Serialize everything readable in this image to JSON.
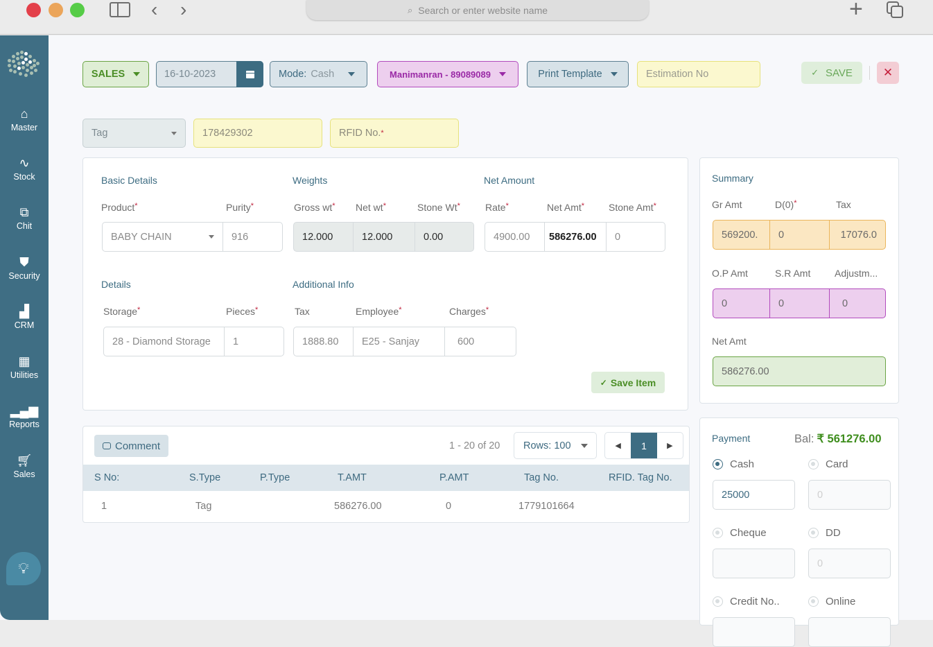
{
  "browser": {
    "url_placeholder": "Search or enter website name"
  },
  "sidebar": {
    "items": [
      {
        "label": "Master",
        "icon": "home-icon"
      },
      {
        "label": "Stock",
        "icon": "activity-icon"
      },
      {
        "label": "Chit",
        "icon": "expand-icon"
      },
      {
        "label": "Security",
        "icon": "shield-icon"
      },
      {
        "label": "CRM",
        "icon": "crm-icon"
      },
      {
        "label": "Utilities",
        "icon": "spreadsheet-icon"
      },
      {
        "label": "Reports",
        "icon": "bar-chart-icon"
      },
      {
        "label": "Sales",
        "icon": "cart-icon"
      }
    ]
  },
  "toolbar": {
    "sales_label": "SALES",
    "date": "16-10-2023",
    "mode_label": "Mode:",
    "mode_value": "Cash",
    "customer": "Manimanran - 89089089",
    "print_template": "Print Template",
    "estimation_placeholder": "Estimation No",
    "save_label": "SAVE",
    "close_label": "✕"
  },
  "tag_row": {
    "tag_select": "Tag",
    "tag_number": "178429302",
    "rfid_placeholder": "RFID No."
  },
  "basic_details": {
    "title": "Basic Details",
    "product_label": "Product",
    "product_value": "BABY CHAIN",
    "purity_label": "Purity",
    "purity_value": "916"
  },
  "weights": {
    "title": "Weights",
    "gross_label": "Gross wt",
    "gross_value": "12.000",
    "net_label": "Net wt",
    "net_value": "12.000",
    "stone_label": "Stone Wt",
    "stone_value": "0.00"
  },
  "net_amount": {
    "title": "Net Amount",
    "rate_label": "Rate",
    "rate_value": "4900.00",
    "netamt_label": "Net Amt",
    "netamt_value": "586276.00",
    "stoneamt_label": "Stone Amt",
    "stoneamt_value": "0"
  },
  "details": {
    "title": "Details",
    "storage_label": "Storage",
    "storage_value": "28 - Diamond Storage",
    "pieces_label": "Pieces",
    "pieces_value": "1"
  },
  "additional_info": {
    "title": "Additional Info",
    "tax_label": "Tax",
    "tax_value": "1888.80",
    "employee_label": "Employee",
    "employee_value": "E25 - Sanjay",
    "charges_label": "Charges",
    "charges_value": "600"
  },
  "save_item_label": "Save Item",
  "list": {
    "comment_label": "Comment",
    "page_info": "1 - 20 of 20",
    "rows_label": "Rows: 100",
    "current_page": "1",
    "columns": [
      "S No:",
      "S.Type",
      "P.Type",
      "T.AMT",
      "P.AMT",
      "Tag No.",
      "RFID. Tag No."
    ],
    "rows": [
      [
        "1",
        "Tag",
        "",
        "586276.00",
        "0",
        "1779101664",
        ""
      ]
    ]
  },
  "summary": {
    "title": "Summary",
    "gr_amt_label": "Gr Amt",
    "gr_amt_value": "569200.",
    "discount_label": "D(0)",
    "discount_value": "0",
    "tax_label": "Tax",
    "tax_value": "17076.0",
    "op_amt_label": "O.P Amt",
    "op_amt_value": "0",
    "sr_amt_label": "S.R Amt",
    "sr_amt_value": "0",
    "adjust_label": "Adjustm...",
    "adjust_value": "0",
    "net_amt_label": "Net Amt",
    "net_amt_value": "586276.00"
  },
  "payment": {
    "title": "Payment",
    "bal_label": "Bal:",
    "bal_value": "₹ 561276.00",
    "methods": [
      {
        "label": "Cash",
        "value": "25000",
        "selected": true
      },
      {
        "label": "Card",
        "value": "0",
        "selected": false
      },
      {
        "label": "Cheque",
        "value": "",
        "selected": false
      },
      {
        "label": "DD",
        "value": "0",
        "selected": false
      },
      {
        "label": "Credit No..",
        "value": "",
        "selected": false
      },
      {
        "label": "Online",
        "value": "",
        "selected": false
      }
    ]
  },
  "colors": {
    "sidebar": "#3f6e84",
    "accent": "#3d6c82",
    "success": "#4b8e26",
    "customer": "#9a2aa6",
    "danger": "#c51f3b"
  }
}
